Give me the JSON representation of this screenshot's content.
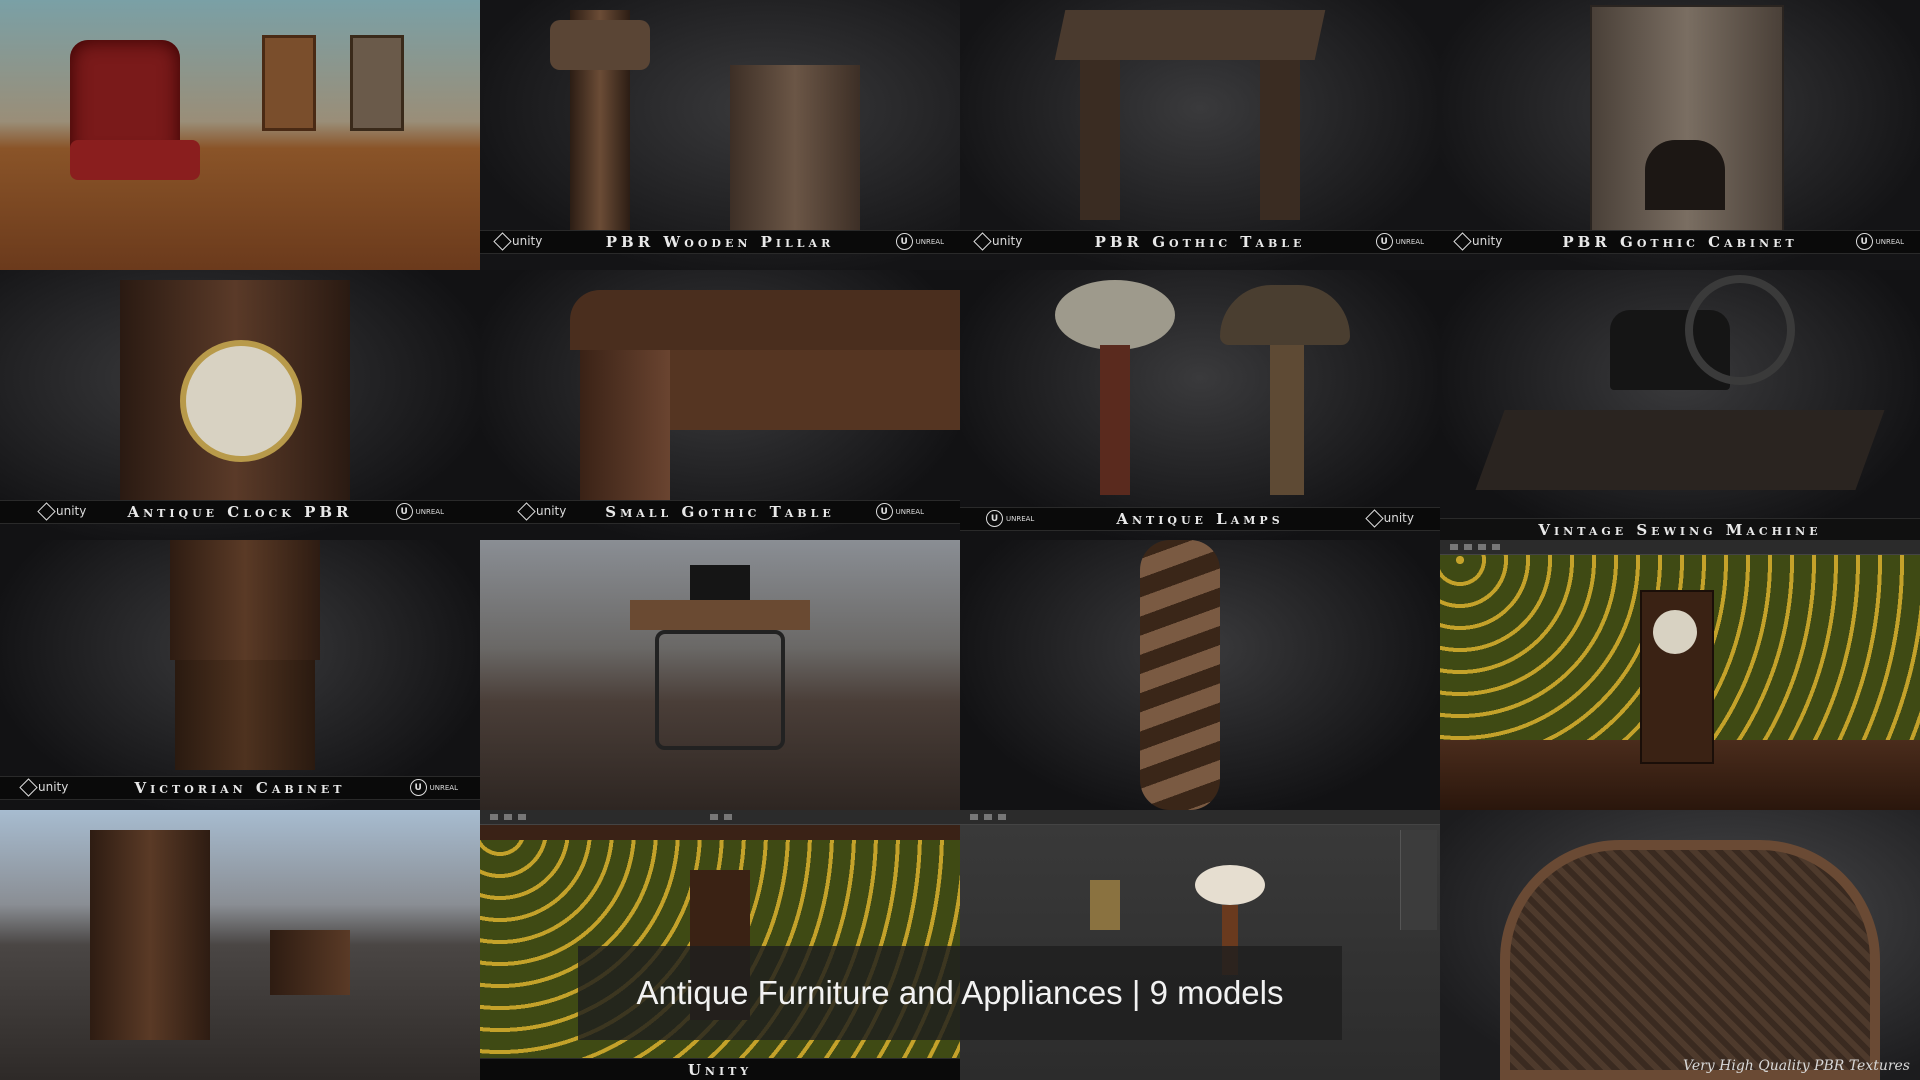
{
  "tiles": {
    "pbr_wooden_pillar": "PBR Wooden Pillar",
    "pbr_gothic_table": "PBR Gothic Table",
    "pbr_gothic_cabinet": "PBR Gothic Cabinet",
    "antique_clock_pbr": "Antique Clock PBR",
    "small_gothic_table": "Small Gothic Table",
    "antique_lamps": "Antique Lamps",
    "vintage_sewing_machine": "Vintage Sewing Machine",
    "victorian_cabinet": "Victorian Cabinet",
    "unity": "Unity"
  },
  "logos": {
    "unity": "unity",
    "unreal": "UNREAL",
    "unreal_mark": "U"
  },
  "caption": "Antique Furniture and Appliances  | 9 models",
  "watermark": "Very High Quality PBR Textures",
  "icons": [
    "unity-logo-icon",
    "unreal-logo-icon"
  ],
  "colors": {
    "banner": "#0a0a0a",
    "wallpaper_green": "#3f4a14",
    "wallpaper_gold": "#c4a22a",
    "wood": "#5a3a24",
    "leather_red": "#8a1e1e"
  }
}
